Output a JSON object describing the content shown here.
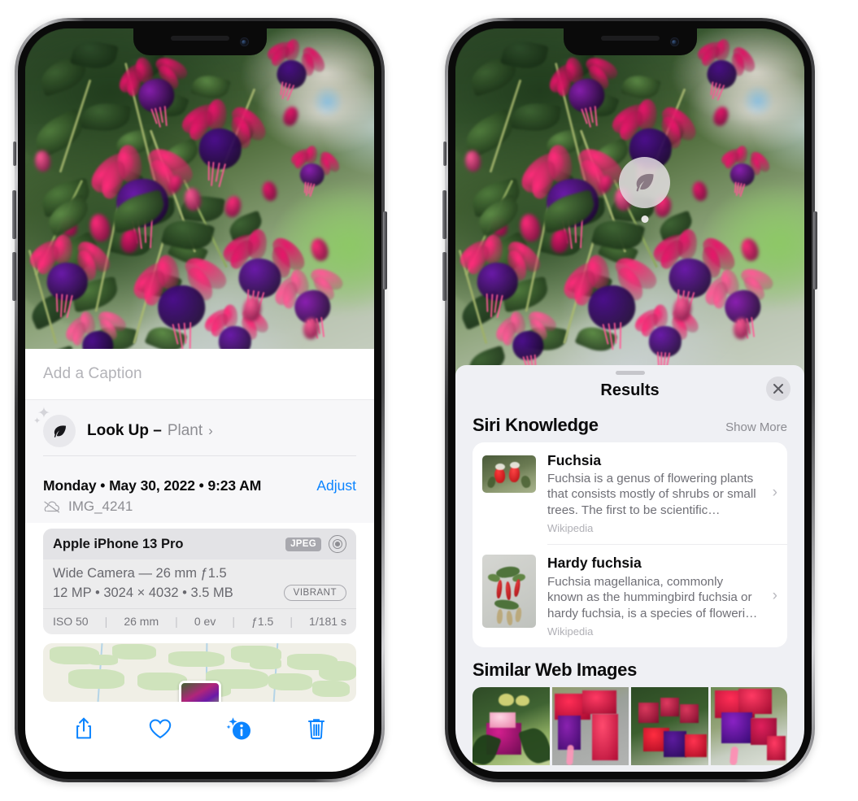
{
  "left_phone": {
    "name": "photos-info-screen",
    "caption": {
      "placeholder": "Add a Caption",
      "value": ""
    },
    "lookup": {
      "label": "Look Up –",
      "subject": "Plant",
      "chevron": "›",
      "icon": "leaf-icon"
    },
    "meta": {
      "date_line": "Monday • May 30, 2022 • 9:23 AM",
      "adjust_label": "Adjust",
      "filename": "IMG_4241",
      "cloud_icon": "cloud-slash-icon"
    },
    "exif": {
      "device": "Apple iPhone 13 Pro",
      "format_badge": "JPEG",
      "aperture_icon": "aperture-icon",
      "lens_line": "Wide Camera — 26 mm ƒ1.5",
      "size_line": "12 MP • 3024 × 4032 • 3.5 MB",
      "style_badge": "VIBRANT",
      "stats": [
        "ISO 50",
        "26 mm",
        "0 ev",
        "ƒ1.5",
        "1/181 s"
      ],
      "separator": "|"
    },
    "toolbar": [
      {
        "name": "share-button",
        "icon": "share-icon"
      },
      {
        "name": "favorite-button",
        "icon": "heart-icon"
      },
      {
        "name": "info-button",
        "icon": "info-sparkle-icon",
        "active": true
      },
      {
        "name": "delete-button",
        "icon": "trash-icon"
      }
    ]
  },
  "right_phone": {
    "name": "visual-lookup-results-screen",
    "leaf_badge": {
      "icon": "leaf-icon"
    },
    "sheet": {
      "title": "Results",
      "close_icon": "close-icon",
      "sections": [
        {
          "heading": "Siri Knowledge",
          "action_label": "Show More",
          "items": [
            {
              "title": "Fuchsia",
              "description": "Fuchsia is a genus of flowering plants that consists mostly of shrubs or small trees. The first to be scientific…",
              "source": "Wikipedia",
              "thumb": "fuchsia-red-white-thumbnail",
              "chevron": "›"
            },
            {
              "title": "Hardy fuchsia",
              "description": "Fuchsia magellanica, commonly known as the hummingbird fuchsia or hardy fuchsia, is a species of floweri…",
              "source": "Wikipedia",
              "thumb": "hardy-fuchsia-branch-thumbnail",
              "chevron": "›"
            }
          ]
        },
        {
          "heading": "Similar Web Images",
          "items": [
            {
              "thumb": "web-image-1-magenta-fuchsia"
            },
            {
              "thumb": "web-image-2-red-fuchsia-closeup"
            },
            {
              "thumb": "web-image-3-red-purple-fuchsia-bush"
            },
            {
              "thumb": "web-image-4-purple-pink-fuchsia"
            }
          ]
        }
      ]
    }
  },
  "colors": {
    "accent_blue": "#0b84ff",
    "sheet_bg": "#eff0f4",
    "card_bg": "#ffffff",
    "secondary_text": "#8e8e93",
    "exif_bg": "#ececed"
  }
}
